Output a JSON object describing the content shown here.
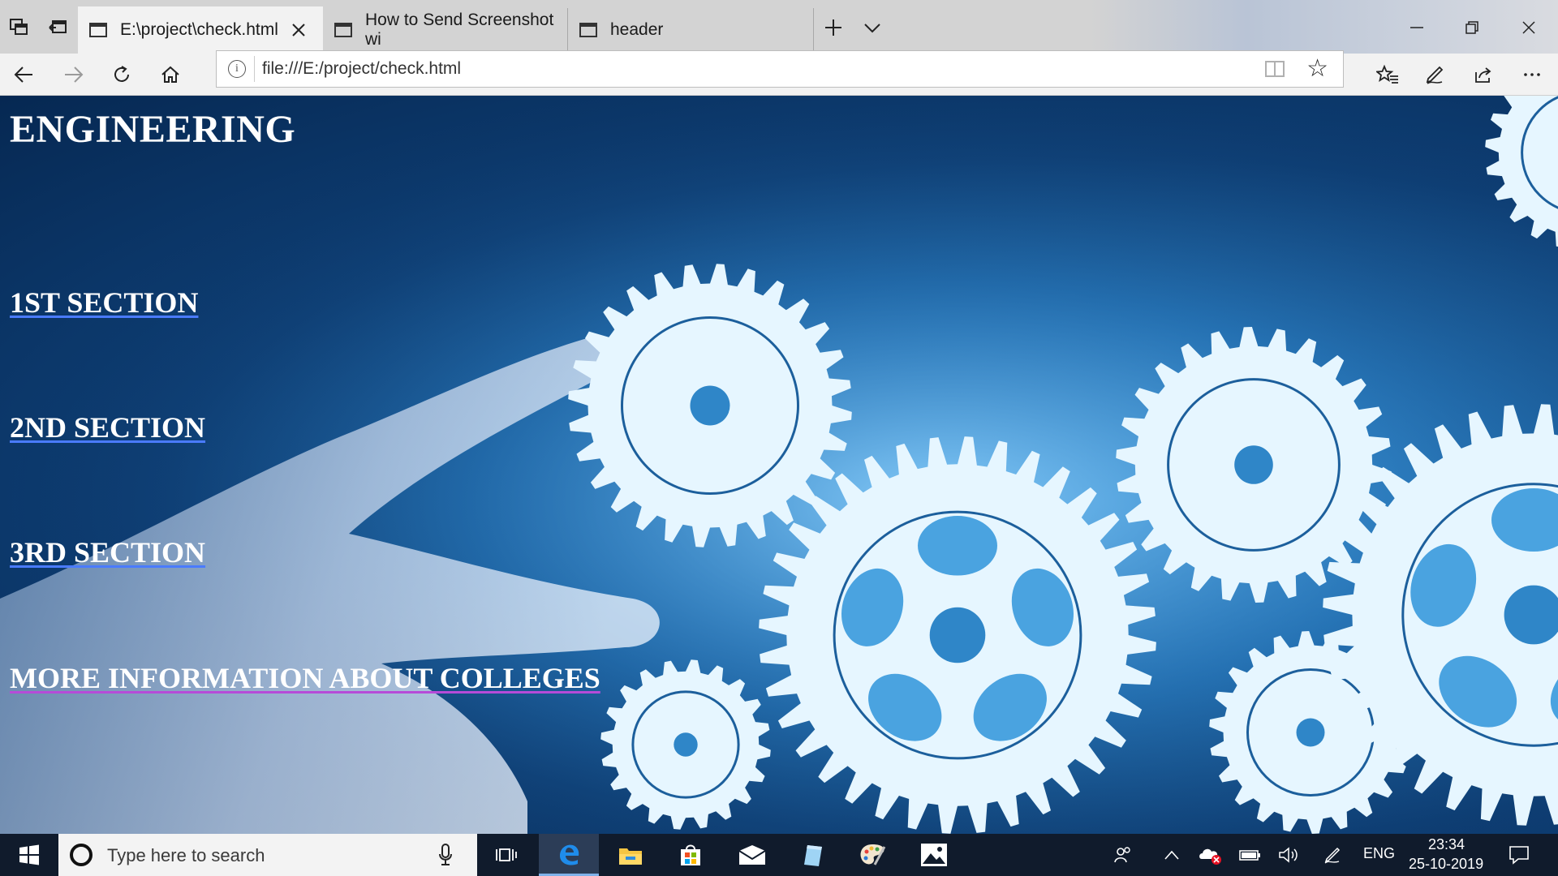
{
  "browser": {
    "tabs": [
      {
        "title": "E:\\project\\check.html",
        "active": true
      },
      {
        "title": "How to Send Screenshot wi",
        "active": false
      },
      {
        "title": "header",
        "active": false
      }
    ],
    "address": "file:///E:/project/check.html"
  },
  "page": {
    "title": "ENGINEERING",
    "links": [
      {
        "label": "1ST SECTION",
        "visited": false
      },
      {
        "label": "2ND SECTION",
        "visited": false
      },
      {
        "label": "3RD SECTION",
        "visited": false
      },
      {
        "label": "MORE INFORMATION ABOUT COLLEGES",
        "visited": true
      }
    ]
  },
  "taskbar": {
    "search_placeholder": "Type here to search",
    "language": "ENG",
    "time": "23:34",
    "date": "25-10-2019"
  },
  "colors": {
    "link_underline": "#4a7bff",
    "visited_underline": "#b64bd8",
    "taskbar": "#101b2c"
  }
}
